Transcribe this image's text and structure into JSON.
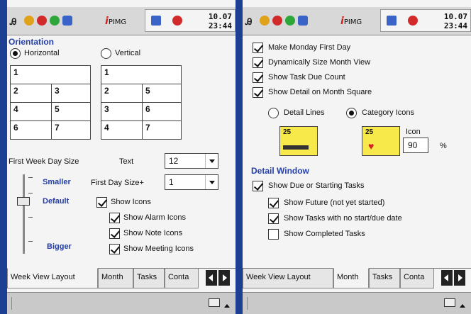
{
  "colors": {
    "background": "#1d3f93",
    "section": "#2540a8",
    "swatch": "#f7e94a"
  },
  "taskbar": {
    "app_label": "PIMG",
    "time": "10.07",
    "seconds": "23:44"
  },
  "left": {
    "orientation_title": "Orientation",
    "horizontal_label": "Horizontal",
    "vertical_label": "Vertical",
    "horizontal_selected": true,
    "grid_h": [
      [
        "1",
        ""
      ],
      [
        "2",
        "3"
      ],
      [
        "4",
        "5"
      ],
      [
        "6",
        "7"
      ]
    ],
    "grid_v": [
      [
        "1",
        ""
      ],
      [
        "2",
        "5"
      ],
      [
        "3",
        "6"
      ],
      [
        "4",
        "7"
      ]
    ],
    "first_week_day_size_label": "First Week Day Size",
    "text_label": "Text",
    "text_size_value": "12",
    "smaller_label": "Smaller",
    "default_label": "Default",
    "bigger_label": "Bigger",
    "first_day_size_label": "First Day Size+",
    "first_day_size_value": "1",
    "show_icons": {
      "label": "Show Icons",
      "checked": true
    },
    "show_alarm_icons": {
      "label": "Show Alarm Icons",
      "checked": true
    },
    "show_note_icons": {
      "label": "Show Note Icons",
      "checked": true
    },
    "show_meeting_icons": {
      "label": "Show Meeting Icons",
      "checked": true
    },
    "tabs": [
      "Week View Layout",
      "Month",
      "Tasks",
      "Conta"
    ],
    "active_tab": 0
  },
  "right": {
    "make_monday_first": {
      "label": "Make Monday First Day",
      "checked": true
    },
    "dynamic_size": {
      "label": "Dynamically Size Month View",
      "checked": true
    },
    "show_task_due": {
      "label": "Show Task Due Count",
      "checked": true
    },
    "show_detail": {
      "label": "Show Detail on Month Square",
      "checked": true
    },
    "detail_lines_label": "Detail Lines",
    "category_icons_label": "Category Icons",
    "category_icons_selected": true,
    "swatch_day_1": "25",
    "swatch_day_2": "25",
    "icon_label": "Icon",
    "icon_value": "90",
    "percent_label": "%",
    "detail_window_title": "Detail Window",
    "show_due_starting": {
      "label": "Show Due or Starting Tasks",
      "checked": true
    },
    "show_future": {
      "label": "Show Future (not yet started)",
      "checked": true
    },
    "show_no_date": {
      "label": "Show Tasks with no start/due date",
      "checked": true
    },
    "show_completed": {
      "label": "Show Completed Tasks",
      "checked": false
    },
    "tabs": [
      "Week View Layout",
      "Month",
      "Tasks",
      "Conta"
    ],
    "active_tab": 1
  },
  "icons": [
    "start-icon",
    "alarm-icon",
    "record-icon",
    "sync-icon",
    "keyboard-icon",
    "tab-left-arrow-icon",
    "tab-right-arrow-icon"
  ]
}
